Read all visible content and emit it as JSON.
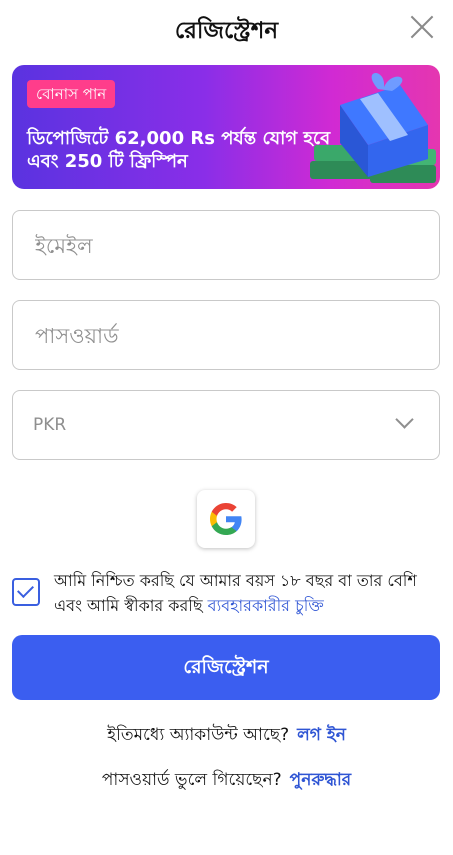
{
  "header": {
    "title": "রেজিস্ট্রেশন"
  },
  "banner": {
    "badge": "বোনাস পান",
    "promo_line1": "ডিপোজিটে 62,000 Rs পর্যন্ত যোগ হবে",
    "promo_line2": "এবং 250 টি ফ্রিস্পিন"
  },
  "form": {
    "email_placeholder": "ইমেইল",
    "password_placeholder": "পাসওয়ার্ড",
    "currency_value": "PKR"
  },
  "agreement": {
    "text": "আমি নিশ্চিত করছি যে আমার বয়স ১৮ বছর বা তার বেশি এবং আমি স্বীকার করছি",
    "link": "ব্যবহারকারীর চুক্তি",
    "checked": true
  },
  "submit_label": "রেজিস্ট্রেশন",
  "login_row": {
    "text": "ইতিমধ্যে অ্যাকাউন্ট আছে?",
    "link": "লগ ইন"
  },
  "recover_row": {
    "text": "পাসওয়ার্ড ভুলে গিয়েছেন?",
    "link": "পুনরুদ্ধার"
  },
  "icons": {
    "close": "close-icon",
    "google": "google-icon",
    "dropdown": "chevron-down-icon",
    "gift": "gift-box-icon"
  },
  "colors": {
    "primary": "#3b5ef0",
    "link": "#2f55d4",
    "badge": "#ff3d8b"
  }
}
